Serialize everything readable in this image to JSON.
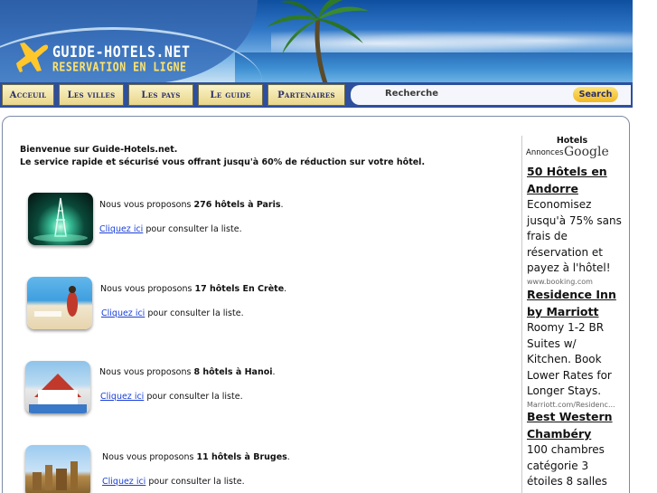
{
  "header": {
    "logo_line1": "GUIDE-HOTELS.NET",
    "logo_line2": "RESERVATION EN LIGNE",
    "brand_color": "#2d4f9c",
    "logo_text_color": "#ffe36b"
  },
  "nav": {
    "items": [
      {
        "label": "Acceuil"
      },
      {
        "label": "Les villes"
      },
      {
        "label": "Les pays"
      },
      {
        "label": "Le guide"
      },
      {
        "label": "Partenaires"
      }
    ],
    "search_label": "Recherche",
    "search_button": "Search"
  },
  "main": {
    "welcome_line1": "Bienvenue sur Guide-Hotels.net.",
    "welcome_line2": "Le service rapide et sécurisé vous offrant jusqu'à 60% de réduction sur votre hôtel.",
    "offers": [
      {
        "prefix": "Nous vous proposons ",
        "bold": "276 hôtels à Paris",
        "suffix": ".",
        "link": "Cliquez ici",
        "link_suffix": " pour consulter la liste.",
        "image": "eiffel-tower-night"
      },
      {
        "prefix": "Nous vous proposons ",
        "bold": "17 hôtels En Crète",
        "suffix": ".",
        "link": "Cliquez ici",
        "link_suffix": " pour consulter la liste.",
        "image": "crete-beach"
      },
      {
        "prefix": "Nous vous proposons ",
        "bold": "8 hôtels à Hanoi",
        "suffix": ".",
        "link": "Cliquez ici",
        "link_suffix": " pour consulter la liste.",
        "image": "resort-hotel"
      },
      {
        "prefix": "Nous vous proposons ",
        "bold": "11 hôtels à Bruges",
        "suffix": ".",
        "link": "Cliquez ici",
        "link_suffix": " pour consulter la liste.",
        "image": "bruges-city"
      }
    ],
    "link_color": "#1a3fd8"
  },
  "sidebar": {
    "heading": "Hotels",
    "annonces": "Annonces",
    "google": "Google",
    "ads": [
      {
        "title": "50 Hôtels en Andorre",
        "body": "Economisez jusqu'à 75% sans frais de réservation et payez à l'hôtel!",
        "url": "www.booking.com"
      },
      {
        "title": "Residence Inn by Marriott",
        "body": "Roomy 1-2 BR Suites w/ Kitchen. Book Lower Rates for Longer Stays.",
        "url": "Marriott.com/Residenc..."
      },
      {
        "title": "Best Western Chambéry",
        "body": "100 chambres catégorie 3 étoiles 8 salles",
        "url": ""
      }
    ]
  }
}
